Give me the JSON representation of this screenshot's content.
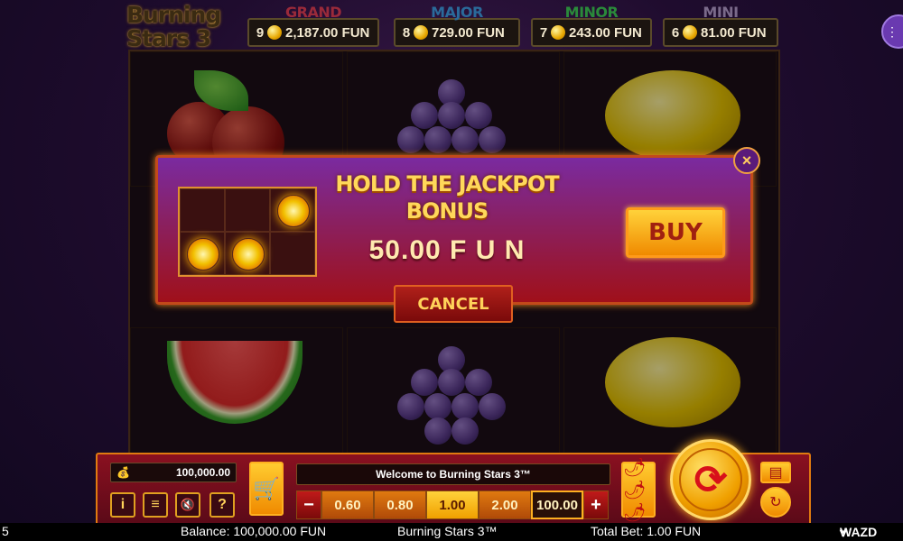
{
  "logo": {
    "line1": "Burning",
    "line2": "Stars 3"
  },
  "jackpots": [
    {
      "name": "GRAND",
      "count": "9",
      "value": "2,187.00 FUN",
      "color": "#9a2a3a"
    },
    {
      "name": "MAJOR",
      "count": "8",
      "value": "729.00 FUN",
      "color": "#2a6a9a"
    },
    {
      "name": "MINOR",
      "count": "7",
      "value": "243.00 FUN",
      "color": "#2a8a3a"
    },
    {
      "name": "MINI",
      "count": "6",
      "value": "81.00 FUN",
      "color": "#7a6a8a"
    }
  ],
  "popup": {
    "title_line1": "HOLD THE JACKPOT",
    "title_line2": "BONUS",
    "price": "50.00 F U N",
    "buy_label": "BUY",
    "cancel_label": "CANCEL",
    "close_symbol": "×"
  },
  "panel": {
    "balance_value": "100,000.00",
    "message": "Welcome to Burning Stars 3™",
    "bets": [
      "0.60",
      "0.80",
      "1.00",
      "2.00",
      "100.00"
    ],
    "selected_bet": "1.00",
    "minus": "−",
    "plus": "+",
    "info_symbol": "i",
    "menu_symbol": "≡",
    "help_symbol": "?"
  },
  "status_bar": {
    "left_fragment": "5",
    "balance": "Balance: 100,000.00 FUN",
    "game": "Burning Stars 3™",
    "total_bet": "Total Bet: 1.00 FUN",
    "brand": "WAZD"
  }
}
